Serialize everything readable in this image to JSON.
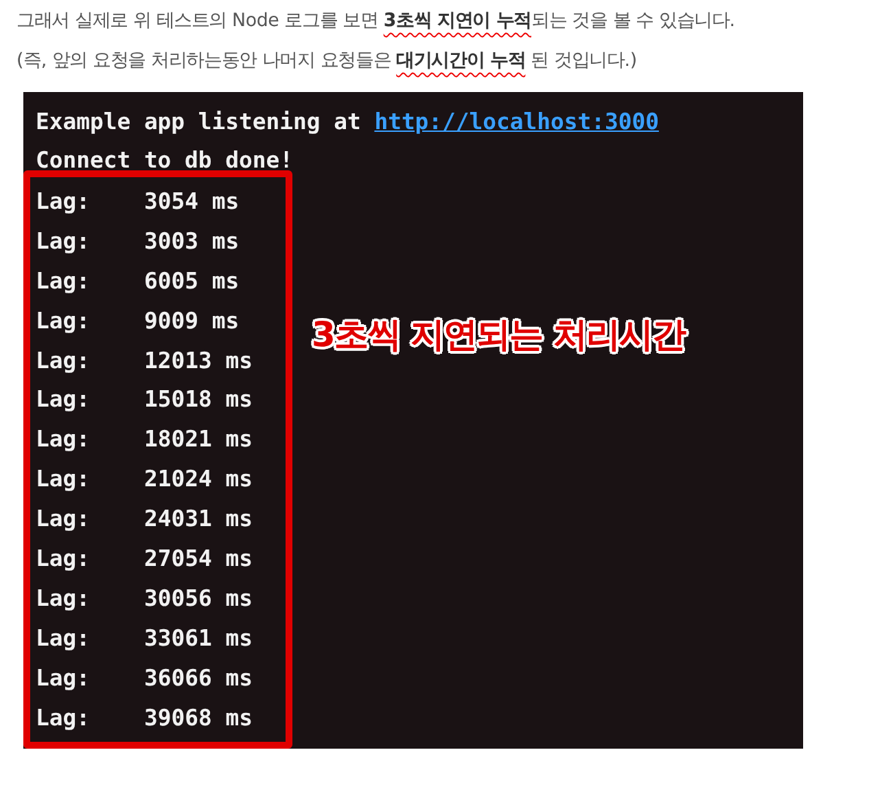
{
  "paragraphs": [
    "그래서 실제로 위 테스트의 Node 로그를 보면 **3초씩 지연이 누적**되는 것을 볼 수 있습니다.",
    "(즉, 앞의 요청을 처리하는동안 나머지 요청들은 **대기시간이 누적** 된 것입니다.)"
  ],
  "terminal": {
    "lines": [
      {
        "kind": "text",
        "text": "Example app listening at "
      },
      {
        "kind": "link",
        "text": "http://localhost:3000"
      }
    ],
    "status": "Connect to db done!",
    "lag_rows": [
      {
        "label": "Lag:",
        "value": "3054 ms"
      },
      {
        "label": "Lag:",
        "value": "3003 ms"
      },
      {
        "label": "Lag:",
        "value": "6005 ms"
      },
      {
        "label": "Lag:",
        "value": "9009 ms"
      },
      {
        "label": "Lag:",
        "value": "12013 ms"
      },
      {
        "label": "Lag:",
        "value": "15018 ms"
      },
      {
        "label": "Lag:",
        "value": "18021 ms"
      },
      {
        "label": "Lag:",
        "value": "21024 ms"
      },
      {
        "label": "Lag:",
        "value": "24031 ms"
      },
      {
        "label": "Lag:",
        "value": "27054 ms"
      },
      {
        "label": "Lag:",
        "value": "30056 ms"
      },
      {
        "label": "Lag:",
        "value": "33061 ms"
      },
      {
        "label": "Lag:",
        "value": "36066 ms"
      },
      {
        "label": "Lag:",
        "value": "39068 ms"
      }
    ],
    "annotation": "3초씩 지연되는 처리시간"
  }
}
